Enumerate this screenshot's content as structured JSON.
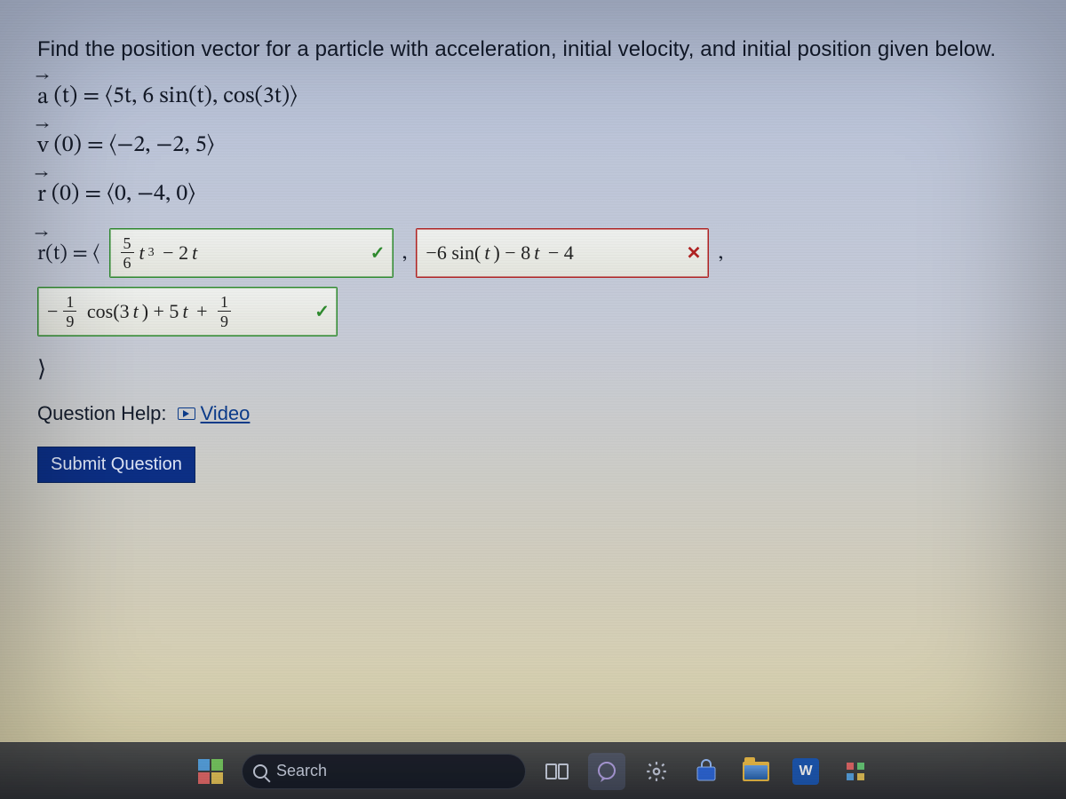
{
  "question": {
    "prompt": "Find the position vector for a particle with acceleration, initial velocity, and initial position given below.",
    "a_t": "⟨5t, 6 sin(t), cos(3t)⟩",
    "v_0": "⟨−2, −2, 5⟩",
    "r_0": "⟨0, −4, 0⟩",
    "answer_label_lhs": "r(t) = ⟨",
    "answers": {
      "component1": {
        "value": "(5/6) t^3 − 2t",
        "display_plain_left": "",
        "status": "correct"
      },
      "component2": {
        "value": "−6 sin(t) − 8t − 4",
        "status": "incorrect"
      },
      "component3": {
        "value": "−(1/9) cos(3t) + 5t + 1/9",
        "status": "correct"
      }
    },
    "closing_bracket": "⟩"
  },
  "help": {
    "label": "Question Help:",
    "video_label": "Video"
  },
  "submit_label": "Submit Question",
  "taskbar": {
    "search_placeholder": "Search",
    "word_glyph": "W"
  },
  "marks": {
    "correct": "✓",
    "incorrect": "✕"
  },
  "sep": ","
}
